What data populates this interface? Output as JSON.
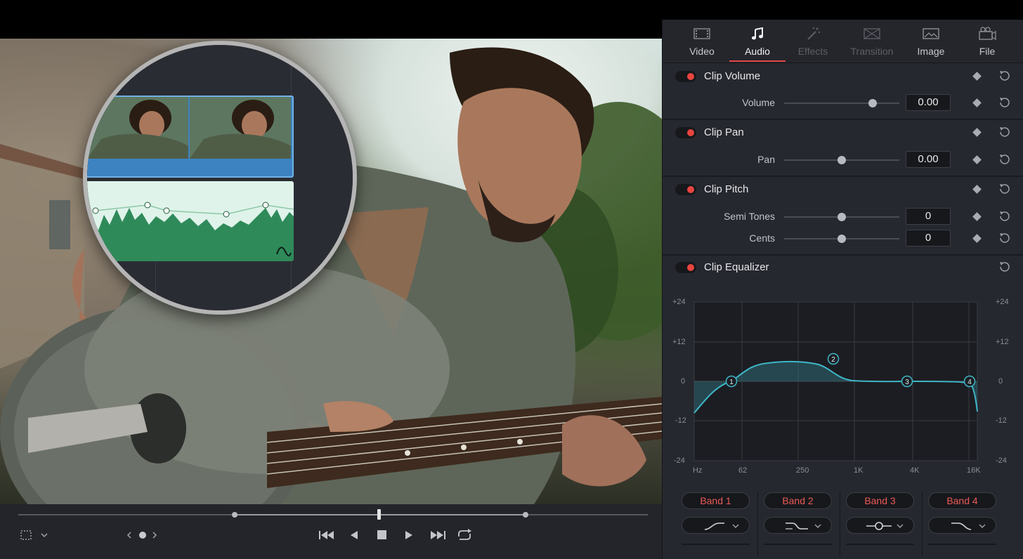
{
  "inspector": {
    "tabs": [
      {
        "label": "Video",
        "icon": "film-icon",
        "state": "normal"
      },
      {
        "label": "Audio",
        "icon": "music-note-icon",
        "state": "active"
      },
      {
        "label": "Effects",
        "icon": "magic-wand-icon",
        "state": "disabled"
      },
      {
        "label": "Transition",
        "icon": "transition-icon",
        "state": "disabled"
      },
      {
        "label": "Image",
        "icon": "image-icon",
        "state": "normal"
      },
      {
        "label": "File",
        "icon": "film-reel-icon",
        "state": "normal"
      }
    ],
    "clip_volume": {
      "title": "Clip Volume",
      "enabled": true,
      "params": [
        {
          "label": "Volume",
          "value": "0.00",
          "slider": 0.77
        }
      ]
    },
    "clip_pan": {
      "title": "Clip Pan",
      "enabled": true,
      "params": [
        {
          "label": "Pan",
          "value": "0.00",
          "slider": 0.5
        }
      ]
    },
    "clip_pitch": {
      "title": "Clip Pitch",
      "enabled": true,
      "params": [
        {
          "label": "Semi Tones",
          "value": "0",
          "slider": 0.5
        },
        {
          "label": "Cents",
          "value": "0",
          "slider": 0.5
        }
      ]
    },
    "clip_equalizer": {
      "title": "Clip Equalizer",
      "enabled": true,
      "y_ticks": [
        "+24",
        "+12",
        "0",
        "-12",
        "-24"
      ],
      "x_ticks": [
        "Hz",
        "62",
        "250",
        "1K",
        "4K",
        "16K"
      ],
      "bands": [
        {
          "label": "Band 1",
          "shape": "high-pass-icon"
        },
        {
          "label": "Band 2",
          "shape": "low-shelf-icon"
        },
        {
          "label": "Band 3",
          "shape": "bell-icon"
        },
        {
          "label": "Band 4",
          "shape": "low-pass-icon"
        }
      ],
      "nodes": [
        "1",
        "2",
        "3",
        "4"
      ]
    }
  },
  "transport": {
    "icons": [
      "crop-icon",
      "chevron-down-icon",
      "prev-clip-icon",
      "clip-dot-icon",
      "next-clip-icon",
      "skip-to-start-icon",
      "play-reverse-icon",
      "stop-icon",
      "play-icon",
      "skip-to-end-icon",
      "loop-icon"
    ]
  },
  "colors": {
    "accent": "#e5454b",
    "eq_curve": "#3fb6c8",
    "video_clip": "#3d83c2",
    "audio_clip": "#2f8a5a"
  }
}
